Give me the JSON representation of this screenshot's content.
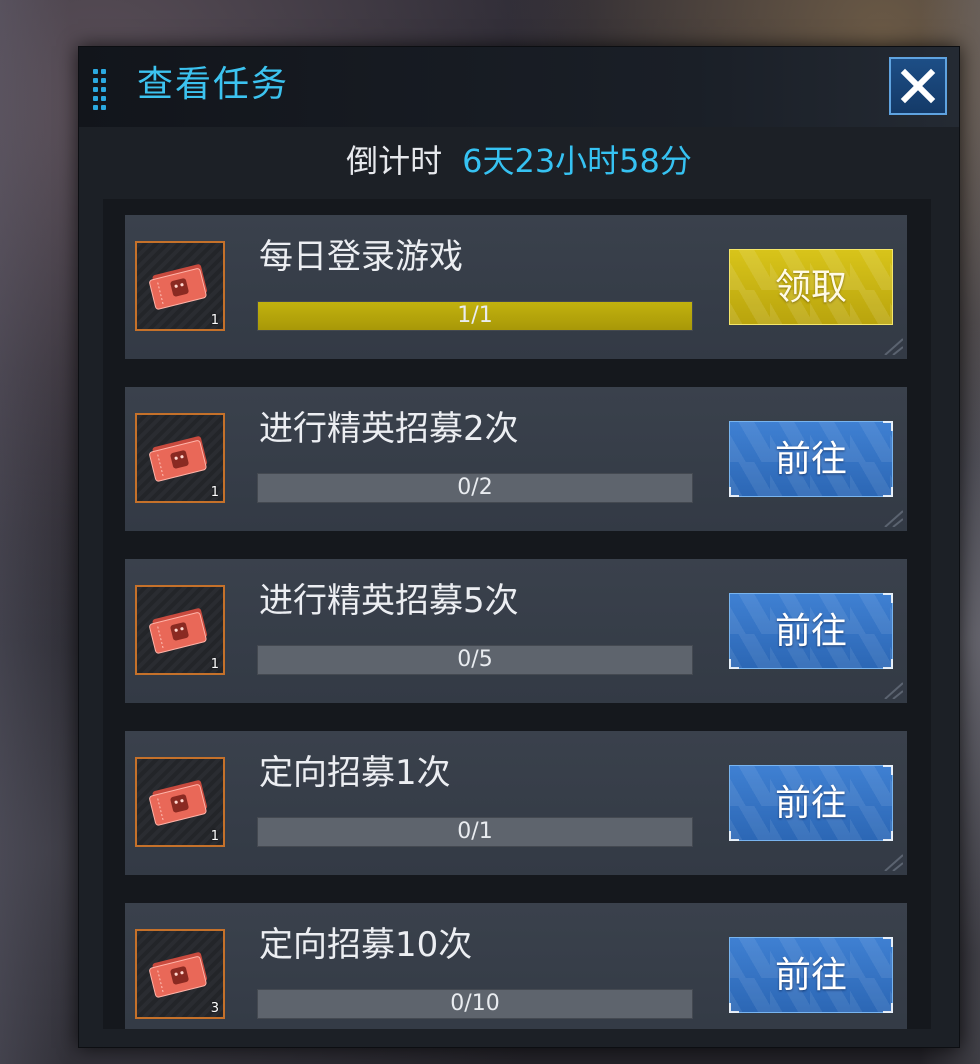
{
  "panel": {
    "title": "查看任务",
    "close_icon": "close-icon"
  },
  "countdown": {
    "label": "倒计时",
    "value": "6天23小时58分"
  },
  "colors": {
    "accent": "#36c2f2",
    "claim_button": "#c9b513",
    "goto_button": "#3570c4",
    "reward_border": "#c5712a",
    "progress_fill": "#b3a30b"
  },
  "tasks": [
    {
      "name": "每日登录游戏",
      "reward_icon": "ticket-icon",
      "reward_count": "1",
      "progress_text": "1/1",
      "progress_fraction": 1.0,
      "button": "领取",
      "button_type": "claim"
    },
    {
      "name": "进行精英招募2次",
      "reward_icon": "ticket-icon",
      "reward_count": "1",
      "progress_text": "0/2",
      "progress_fraction": 0,
      "button": "前往",
      "button_type": "goto"
    },
    {
      "name": "进行精英招募5次",
      "reward_icon": "ticket-icon",
      "reward_count": "1",
      "progress_text": "0/5",
      "progress_fraction": 0,
      "button": "前往",
      "button_type": "goto"
    },
    {
      "name": "定向招募1次",
      "reward_icon": "ticket-icon",
      "reward_count": "1",
      "progress_text": "0/1",
      "progress_fraction": 0,
      "button": "前往",
      "button_type": "goto"
    },
    {
      "name": "定向招募10次",
      "reward_icon": "ticket-icon",
      "reward_count": "3",
      "progress_text": "0/10",
      "progress_fraction": 0,
      "button": "前往",
      "button_type": "goto"
    }
  ]
}
